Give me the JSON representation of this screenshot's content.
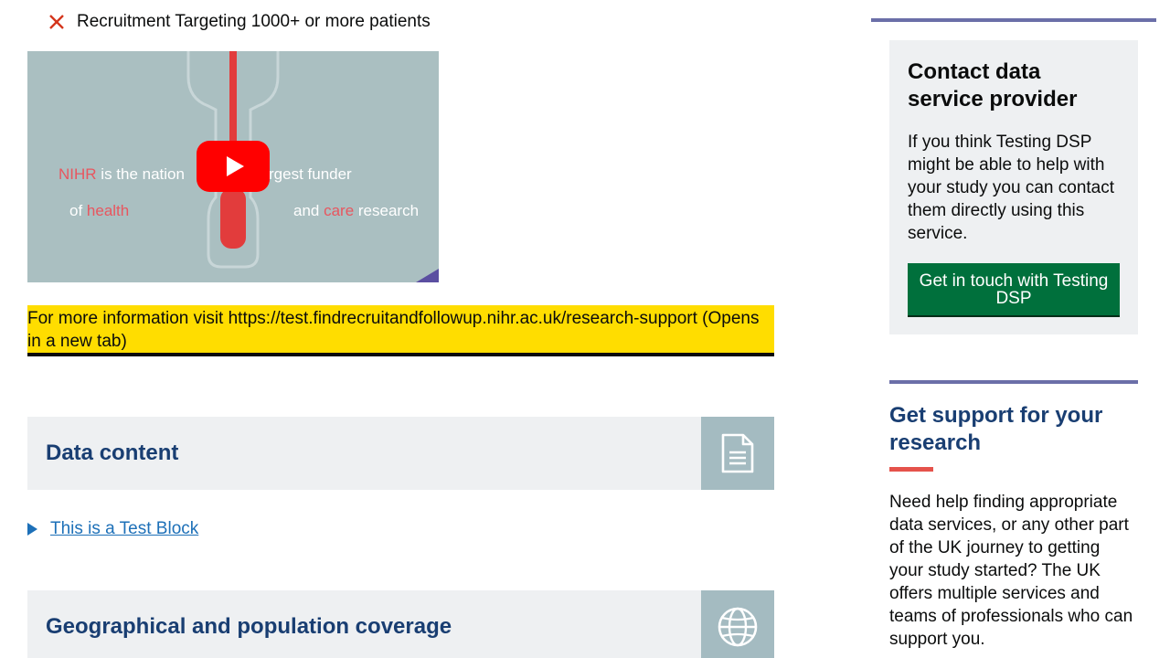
{
  "feature": {
    "icon": "cross-icon",
    "text": "Recruitment Targeting 1000+ or more patients",
    "icon_color": "#d4351c"
  },
  "video": {
    "line1_prefix": "NIHR",
    "line1_rest": " is the nation",
    "line1_suffix": "rgest funder",
    "line2_prefix": "of ",
    "line2_highlight": "health",
    "line2b_prefix": "and ",
    "line2b_highlight": "care",
    "line2b_suffix": " research",
    "play_icon": "play-icon"
  },
  "info_link": {
    "text": "For more information visit https://test.findrecruitandfollowup.nihr.ac.uk/research-support (Opens in a new tab)"
  },
  "sections": {
    "data_content": {
      "title": "Data content",
      "icon": "document-icon"
    },
    "test_block": {
      "label": "This is a Test Block"
    },
    "geo": {
      "title": "Geographical and population coverage",
      "icon": "globe-icon"
    }
  },
  "sidebar": {
    "contact": {
      "title": "Contact data service provider",
      "body": "If you think Testing DSP might be able to help with your study you can contact them directly using this service.",
      "button": "Get in touch with Testing DSP"
    },
    "support": {
      "title": "Get support for your research",
      "body": "Need help finding appropriate data services, or any other part of the UK journey to getting your study started? The UK offers multiple services and teams of professionals who can support you."
    }
  },
  "colors": {
    "accent_green": "#00703c",
    "heading_blue": "#193e72",
    "link_blue": "#1d70b8",
    "highlight_yellow": "#ffdd00",
    "rule_purple": "#6b6fa8",
    "accent_red": "#e5524b"
  }
}
